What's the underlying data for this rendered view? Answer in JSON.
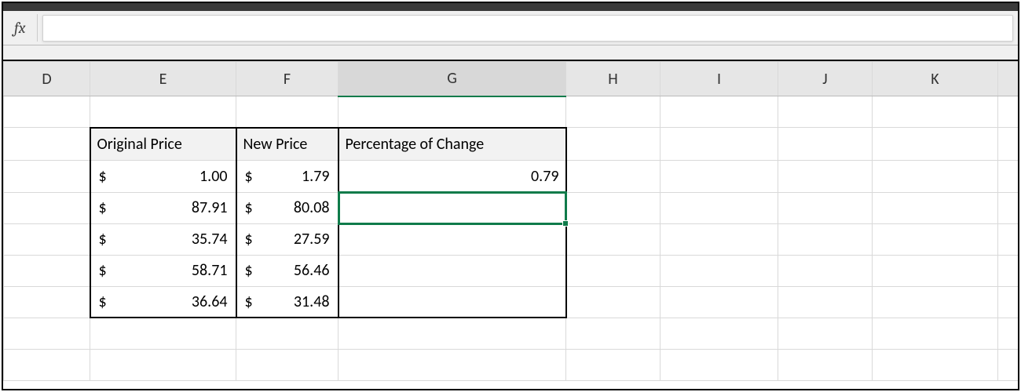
{
  "formula_bar": {
    "fx_label": "fx",
    "value": ""
  },
  "columns": [
    "D",
    "E",
    "F",
    "G",
    "H",
    "I",
    "J",
    "K",
    ""
  ],
  "active_column": "G",
  "table": {
    "headers": {
      "E": "Original Price",
      "F": "New Price",
      "G": "Percentage of Change"
    },
    "rows": [
      {
        "original": "1.00",
        "new": "1.79",
        "pct": "0.79"
      },
      {
        "original": "87.91",
        "new": "80.08",
        "pct": ""
      },
      {
        "original": "35.74",
        "new": "27.59",
        "pct": ""
      },
      {
        "original": "58.71",
        "new": "56.46",
        "pct": ""
      },
      {
        "original": "36.64",
        "new": "31.48",
        "pct": ""
      }
    ],
    "currency_symbol": "$"
  },
  "chart_data": {
    "type": "table",
    "title": "Percentage of Change",
    "columns": [
      "Original Price",
      "New Price",
      "Percentage of Change"
    ],
    "rows": [
      [
        1.0,
        1.79,
        0.79
      ],
      [
        87.91,
        80.08,
        null
      ],
      [
        35.74,
        27.59,
        null
      ],
      [
        58.71,
        56.46,
        null
      ],
      [
        36.64,
        31.48,
        null
      ]
    ]
  },
  "active_cell": {
    "col": "G",
    "row_index": 2
  }
}
